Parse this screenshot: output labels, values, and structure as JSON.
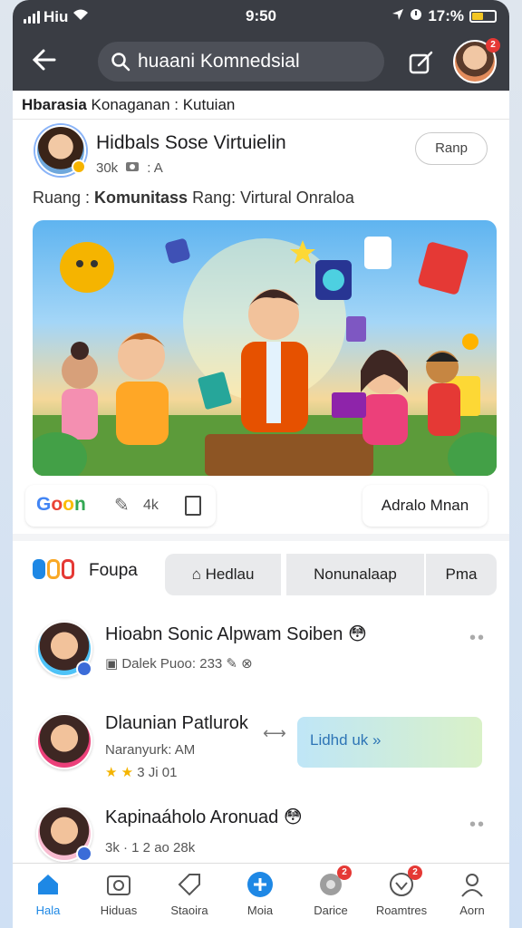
{
  "status": {
    "carrier": "Hiu",
    "time": "9:50",
    "battery": "17:%"
  },
  "header": {
    "search": "huaani Komnedsial"
  },
  "breadcrumb": {
    "bold": "Hbarasia",
    "rest": " Konaganan : Kutuian"
  },
  "post": {
    "title": "Hidbals Sose Virtuielin",
    "meta_count": "30k",
    "meta_tag": ": A",
    "join": "Ranp",
    "desc_pre": "Ruang : ",
    "desc_bold": "Komunitass",
    "desc_post": " Rang: Virtural Onraloa",
    "react_count": "4k",
    "add_label": "Adralo Mnan"
  },
  "tabs": {
    "label": "Foupa",
    "items": [
      "Hedlau",
      "Nonunalaap",
      "Pma"
    ]
  },
  "list": [
    {
      "title": "Hioabn Sonic Alpwam Soiben",
      "meta": "Dalek Puoo: 233"
    },
    {
      "title": "Dlaunian Patlurok",
      "meta": "Naranyurk: AM",
      "rating": "3 Ji 01",
      "promo": "Lidhd uk"
    },
    {
      "title": "Kapinaáholo Aronuad",
      "meta": "3k · 1 2 ao 28k"
    }
  ],
  "nav": {
    "items": [
      {
        "label": "Hala",
        "icon": "home-icon"
      },
      {
        "label": "Hiduas",
        "icon": "camera-icon"
      },
      {
        "label": "Staoira",
        "icon": "tag-icon"
      },
      {
        "label": "Moia",
        "icon": "plus-icon"
      },
      {
        "label": "Darice",
        "icon": "globe-icon"
      },
      {
        "label": "Roamtres",
        "icon": "heart-icon"
      },
      {
        "label": "Aorn",
        "icon": "profile-icon"
      }
    ]
  },
  "colors": {
    "accent": "#1e88e5",
    "header": "#3a3d44",
    "badge": "#e53935"
  }
}
